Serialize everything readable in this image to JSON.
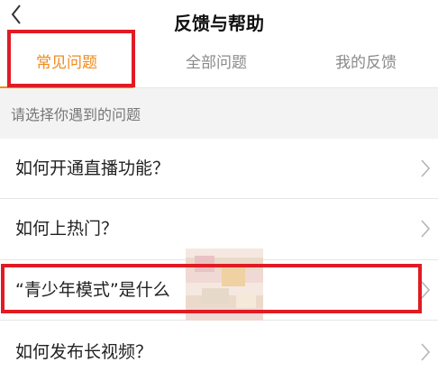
{
  "header": {
    "title": "反馈与帮助",
    "back_icon": "chevron-left-icon"
  },
  "tabs": [
    {
      "label": "常见问题",
      "active": true
    },
    {
      "label": "全部问题",
      "active": false
    },
    {
      "label": "我的反馈",
      "active": false
    }
  ],
  "section": {
    "label": "请选择你遇到的问题"
  },
  "items": [
    {
      "label": "如何开通直播功能？"
    },
    {
      "label": "如何上热门？"
    },
    {
      "label": "“青少年模式”是什么"
    },
    {
      "label": "如何发布长视频？"
    }
  ],
  "colors": {
    "accent": "#f08a1c",
    "highlight": "#e01b24"
  }
}
